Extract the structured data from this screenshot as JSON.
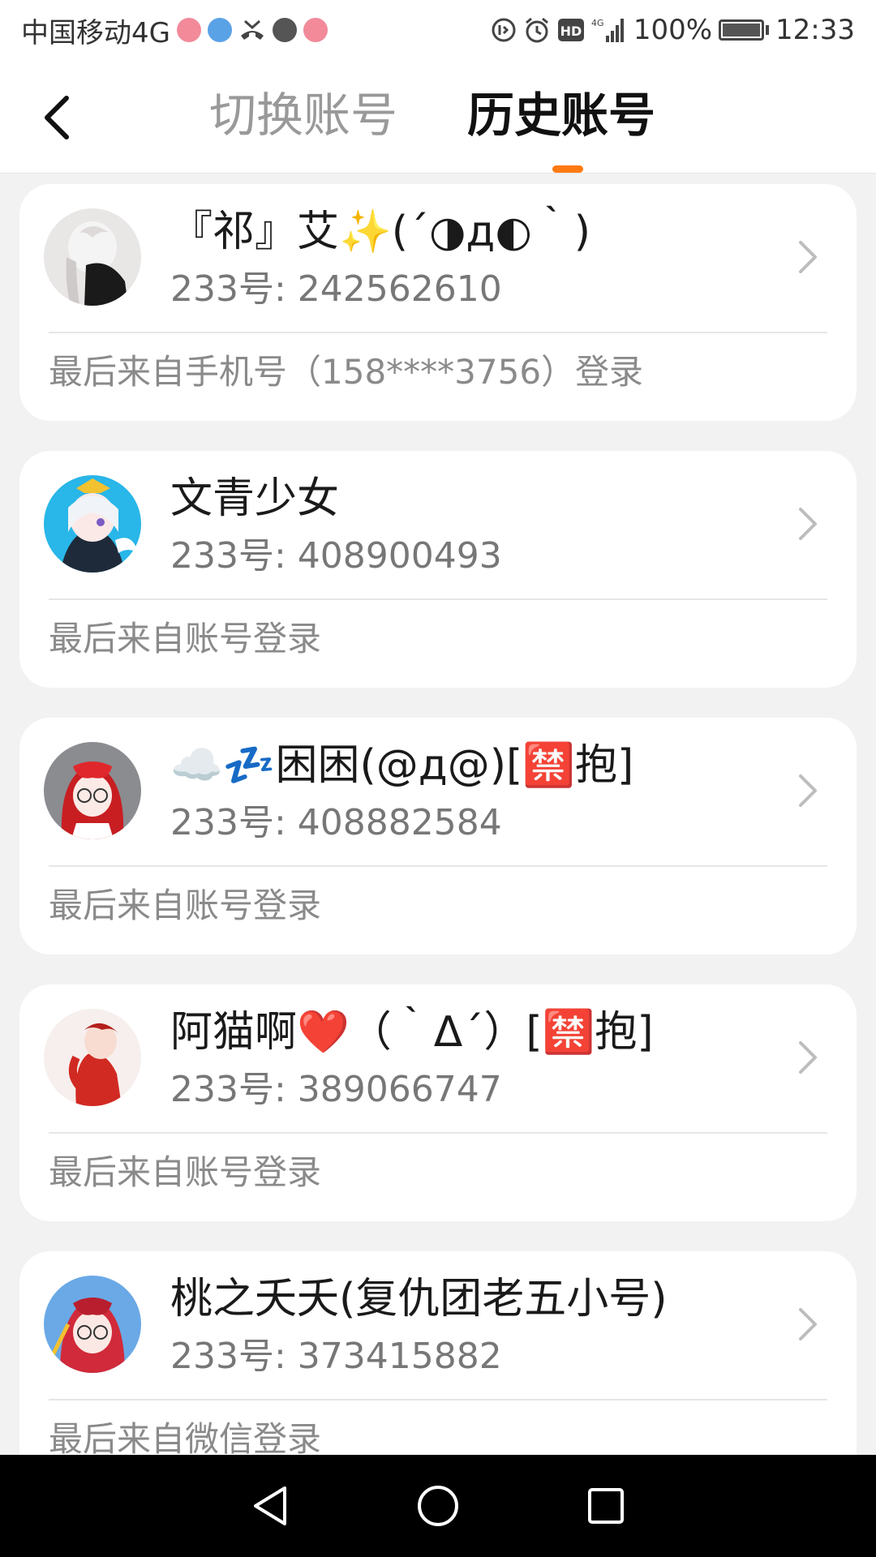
{
  "status_bar": {
    "carrier": "中国移动4G",
    "battery": "100%",
    "time": "12:33",
    "icons": [
      "weibo-icon",
      "browser-icon",
      "missed-call-icon",
      "voice-icon",
      "music-icon",
      "data-saver-icon",
      "alarm-icon",
      "hd-icon",
      "signal-4g-icon",
      "battery-icon"
    ]
  },
  "header": {
    "back_icon": "chevron-left-icon",
    "tabs": [
      {
        "label": "切换账号",
        "active": false
      },
      {
        "label": "历史账号",
        "active": true
      }
    ],
    "accent_color": "#ff7a10"
  },
  "accounts": [
    {
      "name": "『祁』艾✨(´◑д◐｀)",
      "id_text": "233号: 242562610",
      "login_source": "最后来自手机号（158****3756）登录"
    },
    {
      "name": "文青少女",
      "id_text": "233号: 408900493",
      "login_source": "最后来自账号登录"
    },
    {
      "name": "☁️💤困困(@д@)[🈲抱]",
      "id_text": "233号: 408882584",
      "login_source": "最后来自账号登录"
    },
    {
      "name": "阿猫啊❤️（｀Δ´）[🈲抱]",
      "id_text": "233号: 389066747",
      "login_source": "最后来自账号登录"
    },
    {
      "name": "桃之夭夭(复仇团老五小号)",
      "id_text": "233号: 373415882",
      "login_source": "最后来自微信登录"
    }
  ],
  "nav_bar": {
    "buttons": [
      "back-triangle-icon",
      "home-circle-icon",
      "recents-square-icon"
    ]
  }
}
